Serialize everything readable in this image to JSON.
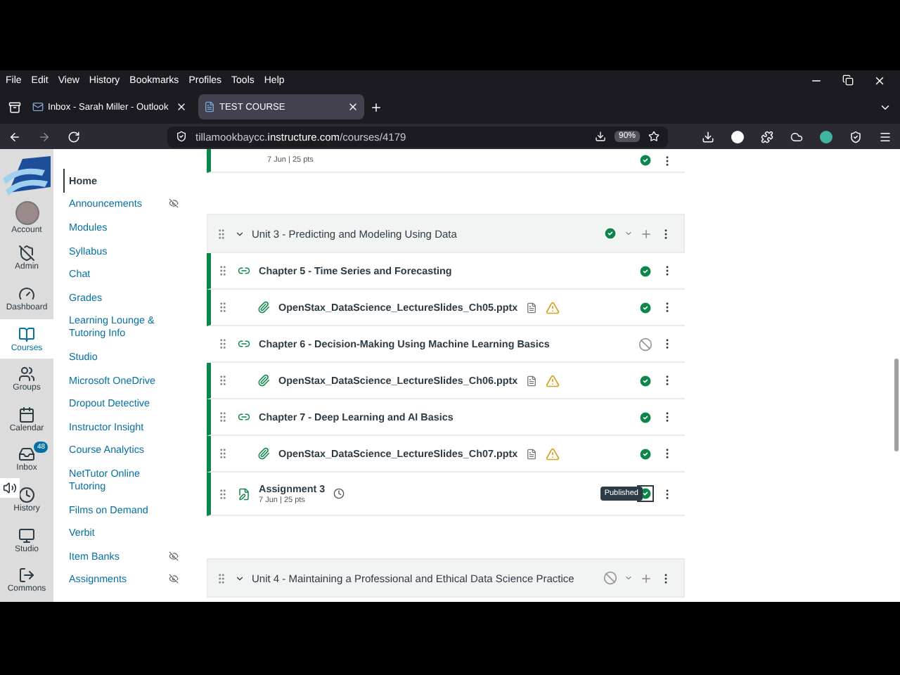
{
  "browser": {
    "menu": [
      "File",
      "Edit",
      "View",
      "History",
      "Bookmarks",
      "Profiles",
      "Tools",
      "Help"
    ],
    "tabs": [
      {
        "title": "Inbox - Sarah Miller - Outlook",
        "selected": false
      },
      {
        "title": "TEST COURSE",
        "selected": true
      }
    ],
    "url": "tillamookbaycc.**instructure.com**/courses/4179",
    "zoom": "90%"
  },
  "global_nav": [
    {
      "label": "Account",
      "kind": "account",
      "selected": false
    },
    {
      "label": "Admin",
      "kind": "admin",
      "selected": false
    },
    {
      "label": "Dashboard",
      "kind": "dashboard",
      "selected": false
    },
    {
      "label": "Courses",
      "kind": "courses",
      "selected": true
    },
    {
      "label": "Groups",
      "kind": "groups",
      "selected": false
    },
    {
      "label": "Calendar",
      "kind": "calendar",
      "selected": false
    },
    {
      "label": "Inbox",
      "kind": "inbox",
      "selected": false,
      "badge": "48"
    },
    {
      "label": "History",
      "kind": "history",
      "selected": false
    },
    {
      "label": "Studio",
      "kind": "studio",
      "selected": false
    },
    {
      "label": "Commons",
      "kind": "commons",
      "selected": false
    }
  ],
  "course_nav": [
    {
      "label": "Home",
      "selected": true,
      "hidden": false
    },
    {
      "label": "Announcements",
      "selected": false,
      "hidden": true
    },
    {
      "label": "Modules",
      "selected": false,
      "hidden": false
    },
    {
      "label": "Syllabus",
      "selected": false,
      "hidden": false
    },
    {
      "label": "Chat",
      "selected": false,
      "hidden": false
    },
    {
      "label": "Grades",
      "selected": false,
      "hidden": false
    },
    {
      "label": "Learning Lounge & Tutoring Info",
      "selected": false,
      "hidden": false
    },
    {
      "label": "Studio",
      "selected": false,
      "hidden": false
    },
    {
      "label": "Microsoft OneDrive",
      "selected": false,
      "hidden": false
    },
    {
      "label": "Dropout Detective",
      "selected": false,
      "hidden": false
    },
    {
      "label": "Instructor Insight",
      "selected": false,
      "hidden": false
    },
    {
      "label": "Course Analytics",
      "selected": false,
      "hidden": false
    },
    {
      "label": "NetTutor Online Tutoring",
      "selected": false,
      "hidden": false
    },
    {
      "label": "Films on Demand",
      "selected": false,
      "hidden": false
    },
    {
      "label": "Verbit",
      "selected": false,
      "hidden": false
    },
    {
      "label": "Item Banks",
      "selected": false,
      "hidden": true
    },
    {
      "label": "Assignments",
      "selected": false,
      "hidden": true
    }
  ],
  "previous_item": {
    "subtitle": "7 Jun | 25 pts",
    "published": true
  },
  "modules": [
    {
      "title": "Unit 3 - Predicting and Modeling Using Data",
      "published": true,
      "items": [
        {
          "kind": "link",
          "title": "Chapter 5 - Time Series and Forecasting",
          "published": true
        },
        {
          "kind": "file",
          "title": "OpenStax_DataScience_LectureSlides_Ch05.pptx",
          "published": true
        },
        {
          "kind": "link",
          "title": "Chapter 6 - Decision-Making Using Machine Learning Basics",
          "published": false
        },
        {
          "kind": "file",
          "title": "OpenStax_DataScience_LectureSlides_Ch06.pptx",
          "published": true
        },
        {
          "kind": "link",
          "title": "Chapter 7 - Deep Learning and AI Basics",
          "published": true
        },
        {
          "kind": "file",
          "title": "OpenStax_DataScience_LectureSlides_Ch07.pptx",
          "published": true
        },
        {
          "kind": "assignment",
          "title": "Assignment 3",
          "subtitle": "7 Jun | 25 pts",
          "published": true,
          "tooltip": "Published"
        }
      ]
    },
    {
      "title": "Unit 4 - Maintaining a Professional and Ethical Data Science Practice",
      "published": false
    }
  ]
}
